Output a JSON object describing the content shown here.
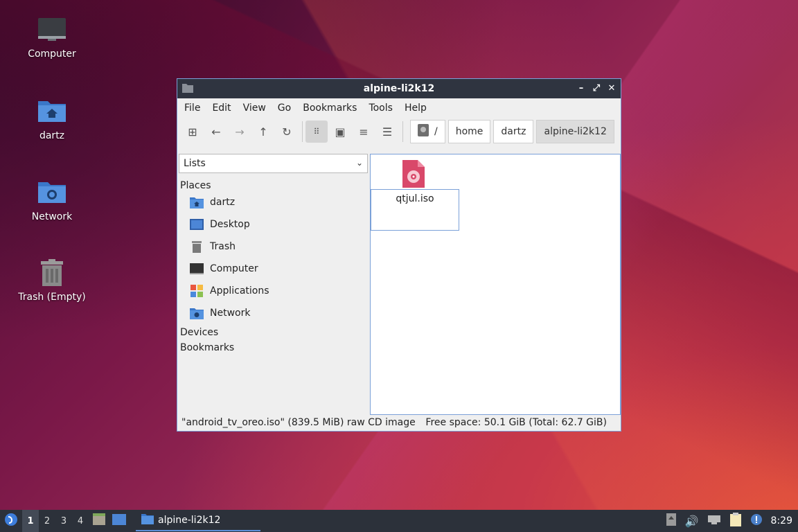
{
  "desktop": {
    "icons": [
      {
        "label": "Computer",
        "icon": "computer-icon"
      },
      {
        "label": "dartz",
        "icon": "home-folder-icon"
      },
      {
        "label": "Network",
        "icon": "network-folder-icon"
      },
      {
        "label": "Trash (Empty)",
        "icon": "trash-icon"
      }
    ]
  },
  "window": {
    "title": "alpine-li2k12",
    "menu": [
      "File",
      "Edit",
      "View",
      "Go",
      "Bookmarks",
      "Tools",
      "Help"
    ],
    "path": [
      "/",
      "home",
      "dartz",
      "alpine-li2k12"
    ],
    "sidebar": {
      "view_select": "Lists",
      "places_header": "Places",
      "places": [
        "dartz",
        "Desktop",
        "Trash",
        "Computer",
        "Applications",
        "Network"
      ],
      "devices_header": "Devices",
      "bookmarks_header": "Bookmarks"
    },
    "file": {
      "rename_value": "qtjul.iso",
      "icon": "cd-image-icon"
    },
    "status": {
      "selection": "\"android_tv_oreo.iso\" (839.5 MiB) raw CD image",
      "free_space": "Free space: 50.1 GiB (Total: 62.7 GiB)"
    }
  },
  "taskbar": {
    "workspaces": [
      "1",
      "2",
      "3",
      "4"
    ],
    "active_workspace": "1",
    "task_title": "alpine-li2k12",
    "clock": "8:29"
  },
  "colors": {
    "accent": "#5b8fd8",
    "titlebar": "#2f3440",
    "taskbar": "#2c313a",
    "iso_icon": "#d9486a"
  }
}
